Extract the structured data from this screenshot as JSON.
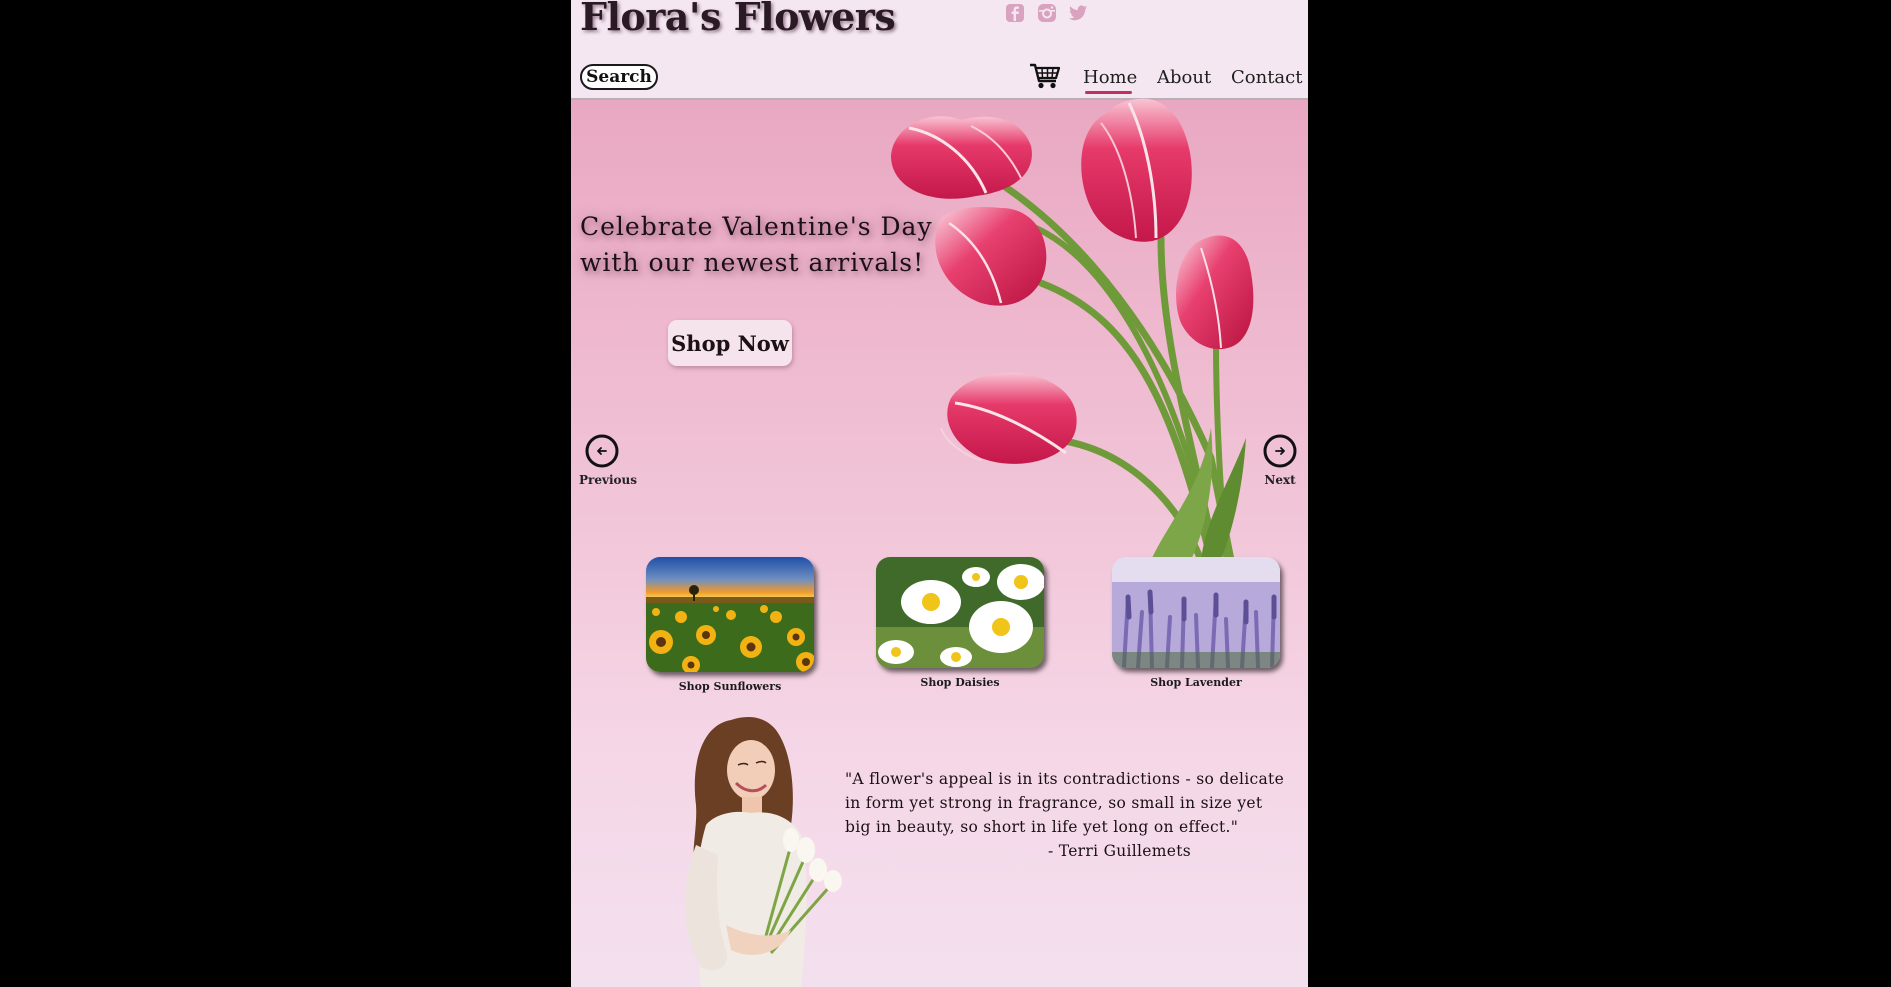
{
  "header": {
    "site_title": "Flora's Flowers",
    "social_icons": [
      "facebook-icon",
      "instagram-icon",
      "twitter-icon"
    ],
    "search_label": "Search",
    "nav": [
      {
        "label": "Home",
        "active": true
      },
      {
        "label": "About",
        "active": false
      },
      {
        "label": "Contact",
        "active": false
      }
    ],
    "accent_color": "#c2305e",
    "social_icon_color": "#d9a3bf"
  },
  "hero": {
    "headline_line1": "Celebrate Valentine's Day",
    "headline_line2": "with our newest arrivals!",
    "cta_label": "Shop Now",
    "prev_label": "Previous",
    "next_label": "Next",
    "image": "pink-tulips"
  },
  "categories": [
    {
      "label": "Shop Sunflowers",
      "image": "sunflower-field"
    },
    {
      "label": "Shop Daisies",
      "image": "daisies"
    },
    {
      "label": "Shop Lavender",
      "image": "lavender-field"
    }
  ],
  "quote": {
    "text": "\"A flower's appeal is in its contradictions - so delicate in form yet strong in fragrance, so small in size yet big in beauty, so short in life yet long on effect.\"",
    "author": "- Terri Guillemets",
    "image": "woman-holding-tulips"
  }
}
